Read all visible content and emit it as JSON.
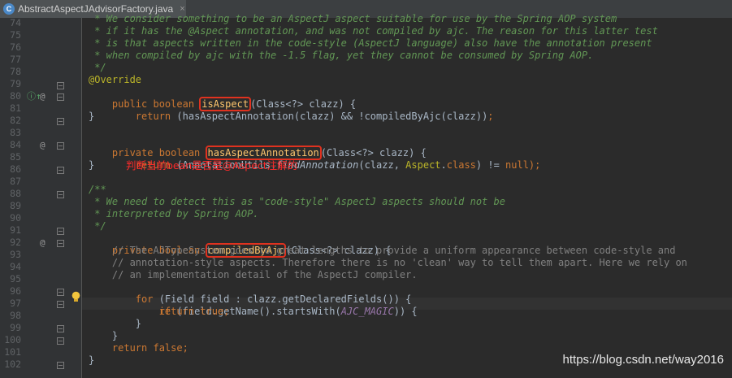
{
  "tab": {
    "filename": "AbstractAspectJAdvisorFactory.java",
    "icon": "C",
    "close": "×"
  },
  "gutter": {
    "lines": [
      "74",
      "75",
      "76",
      "77",
      "78",
      "79",
      "80",
      "81",
      "82",
      "83",
      "84",
      "85",
      "86",
      "87",
      "88",
      "89",
      "90",
      "91",
      "92",
      "93",
      "94",
      "95",
      "96",
      "97",
      "98",
      "99",
      "100",
      "101",
      "102"
    ],
    "override_marker": "@",
    "implements_marker": "ⓘ↑"
  },
  "code": {
    "l73": " * We consider something to be an AspectJ aspect suitable for use by the Spring AOP system",
    "l74": " * if it has the @Aspect annotation, and was not compiled by ajc. The reason for this latter test",
    "l75": " * is that aspects written in the code-style (AspectJ language) also have the annotation present",
    "l76": " * when compiled by ajc with the -1.5 flag, yet they cannot be consumed by Spring AOP.",
    "l77": " */",
    "l78": "@Override",
    "l79_kw": "public boolean ",
    "l79_m": "isAspect",
    "l79_rest": "(Class<?> clazz) {",
    "l80_kw": "    return ",
    "l80_rest": "(hasAspectAnnotation(clazz) && !compiledByAjc(clazz))",
    "l80_semi": ";",
    "l81": "}",
    "l83_kw": "private boolean ",
    "l83_m": "hasAspectAnnotation",
    "l83_rest": "(Class<?> clazz) {",
    "l84_kw": "    return ",
    "l84_a": "(AnnotationUtils.",
    "l84_b": "findAnnotation",
    "l84_c": "(clazz, ",
    "l84_d": "Aspect",
    "l84_e": ".",
    "l84_f": "class",
    "l84_g": ") != ",
    "l84_h": "null",
    "l84_i": ");",
    "l85": "}",
    "annotation_note": "判断当前bean是否是@Aspect注解的",
    "l87": "/**",
    "l88": " * We need to detect this as \"code-style\" AspectJ aspects should not be",
    "l89": " * interpreted by Spring AOP.",
    "l90": " */",
    "l91_kw": "private boolean ",
    "l91_m": "compiledByAjc",
    "l91_rest": "(Class<?> clazz) {",
    "l92": "    // The AJTypeSystem goes to great lengths to provide a uniform appearance between code-style and",
    "l93": "    // annotation-style aspects. Therefore there is no 'clean' way to tell them apart. Here we rely on",
    "l94": "    // an implementation detail of the AspectJ compiler.",
    "l95_kw": "    for ",
    "l95_rest": "(Field field : clazz.getDeclaredFields()) {",
    "l96_kw": "        if ",
    "l96_a": "(field.getName().startsWith(",
    "l96_b": "AJC_MAGIC",
    "l96_c": ")) {",
    "l97": "            return true;",
    "l98": "        }",
    "l99": "    }",
    "l100": "    return false;",
    "l101": "}"
  },
  "watermark": "https://blog.csdn.net/way2016"
}
